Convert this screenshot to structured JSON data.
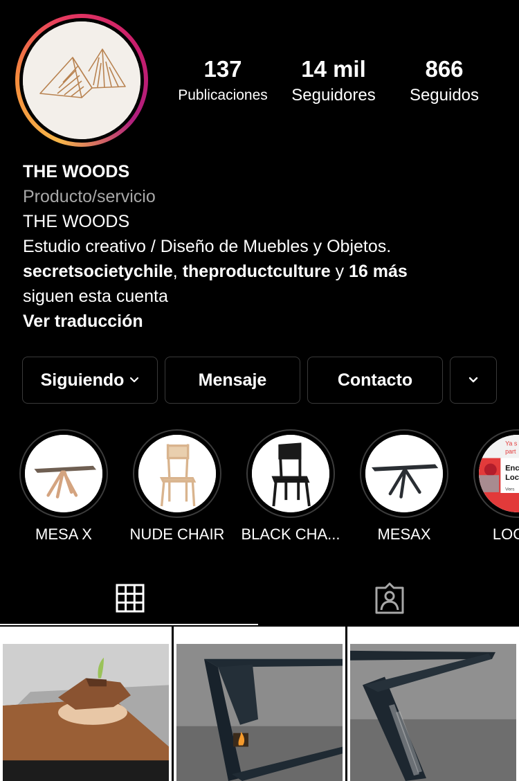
{
  "profile": {
    "stats": [
      {
        "value": "137",
        "label": "Publicaciones"
      },
      {
        "value": "14 mil",
        "label": "Seguidores"
      },
      {
        "value": "866",
        "label": "Seguidos"
      }
    ],
    "name": "THE WOODS",
    "category": "Producto/servicio",
    "bio_line1": "THE WOODS",
    "bio_line2": "Estudio creativo / Diseño de Muebles y Objetos.",
    "followed_by_user1": "secretsocietychile",
    "followed_by_user2": "theproductculture",
    "followed_by_and": "y",
    "followed_by_more": "16 más",
    "followed_by_tail": "siguen esta cuenta",
    "see_translation": "Ver traducción"
  },
  "buttons": {
    "following": "Siguiendo",
    "message": "Mensaje",
    "contact": "Contacto"
  },
  "highlights": [
    {
      "label": "MESA X"
    },
    {
      "label": "NUDE CHAIR"
    },
    {
      "label": "BLACK CHA..."
    },
    {
      "label": "MESAX"
    },
    {
      "label": "LOCAL"
    }
  ],
  "highlight_thumb_text": {
    "line1": "Ya s",
    "line2": "part",
    "line3": "Enc",
    "line4": "Loc",
    "line5": "Vers"
  },
  "tabs": [
    {
      "icon": "grid-icon",
      "active": true
    },
    {
      "icon": "tagged-icon",
      "active": false
    }
  ],
  "colors": {
    "background": "#000000",
    "border": "#3a3a3a",
    "muted_text": "#a8a8a8",
    "story_ring_start": "#f7b64a",
    "story_ring_end": "#c91e6c"
  }
}
